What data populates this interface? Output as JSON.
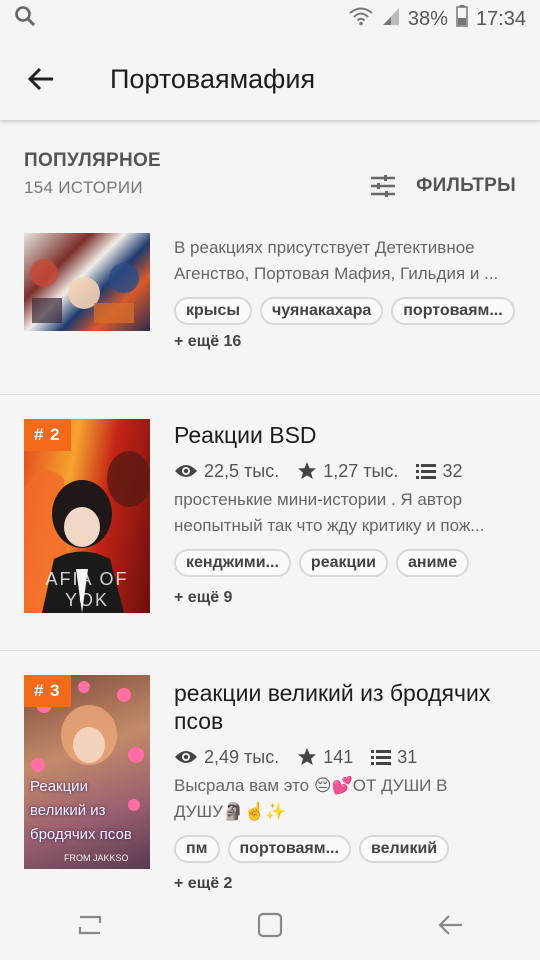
{
  "status": {
    "battery": "38%",
    "time": "17:34"
  },
  "header": {
    "title": "Портоваямафия"
  },
  "section": {
    "title": "ПОПУЛЯРНОЕ",
    "count": "154 ИСТОРИИ",
    "filters_label": "ФИЛЬТРЫ"
  },
  "stories": [
    {
      "rank": "",
      "title": "",
      "desc": "В реакциях присутствует  Детективное Агенство, Портовая Мафия, Гильдия и ...",
      "desc1": "В реакциях присутствует  Детективное",
      "desc2": "Агенство, Портовая Мафия, Гильдия и ...",
      "tags": [
        "крысы",
        "чуянакахара",
        "портоваям..."
      ],
      "more": "+ ещё 16"
    },
    {
      "rank": "# 2",
      "title": "Реакции BSD",
      "reads": "22,5 тыс.",
      "votes": "1,27 тыс.",
      "parts": "32",
      "desc1": "простенькие мини-истории . Я автор",
      "desc2": "неопытный так что жду критику и пож...",
      "tags": [
        "кенджими...",
        "реакции",
        "аниме"
      ],
      "more": "+ ещё 9",
      "cover_text": "AFIA OF YOK"
    },
    {
      "rank": "# 3",
      "title": "реакции великий из бродячих псов",
      "title1": "реакции великий из бродячих",
      "title2": "псов",
      "reads": "2,49 тыс.",
      "votes": "141",
      "parts": "31",
      "desc1": "Высрала вам это 😔💕ОТ ДУШИ В",
      "desc2": "ДУШУ🗿☝️✨",
      "tags": [
        "пм",
        "портоваям...",
        "великий"
      ],
      "more": "+ ещё 2",
      "cover_text": [
        "Реакции",
        "великий из",
        "бродячих псов"
      ],
      "cover_credit": "FROM JAKKSO"
    }
  ],
  "colors": {
    "accent": "#f26a1a",
    "background": "#f5f5f5"
  }
}
